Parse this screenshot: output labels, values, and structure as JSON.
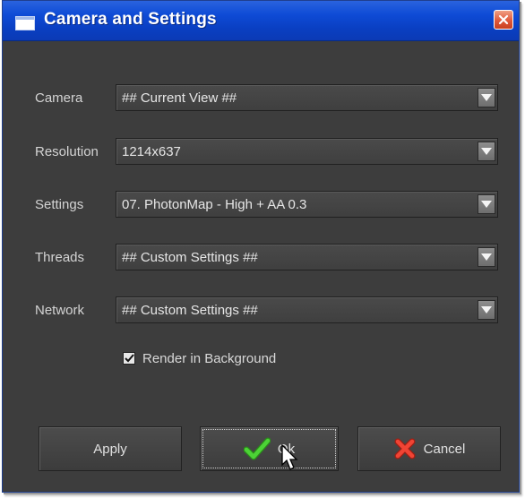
{
  "window": {
    "title": "Camera and Settings",
    "icons": {
      "app": "window-icon",
      "close": "close-icon"
    }
  },
  "fields": [
    {
      "label": "Camera",
      "value": "## Current View ##"
    },
    {
      "label": "Resolution",
      "value": "1214x637"
    },
    {
      "label": "Settings",
      "value": "07. PhotonMap - High + AA 0.3"
    },
    {
      "label": "Threads",
      "value": "## Custom Settings ##"
    },
    {
      "label": "Network",
      "value": "## Custom Settings ##"
    }
  ],
  "render_background": {
    "label": "Render in Background",
    "checked": true
  },
  "buttons": {
    "apply": "Apply",
    "ok": "Ok",
    "cancel": "Cancel"
  },
  "colors": {
    "titlebar": "#0e4bd6",
    "dialog_bg": "#3d3d3d",
    "ok_check": "#3ec22a",
    "cancel_x": "#e23a2a"
  }
}
